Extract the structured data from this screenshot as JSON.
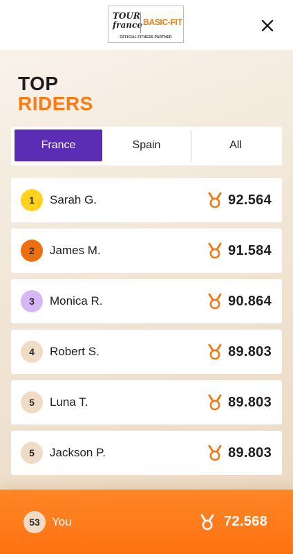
{
  "header": {
    "logo": {
      "tdf_line1": "TOUR",
      "tdf_line2": "france",
      "brand": "BASIC-FIT",
      "partner_text": "OFFICIAL FITNESS PARTNER"
    },
    "close_icon": "close-icon"
  },
  "title": {
    "line1": "TOP",
    "line2": "RIDERS"
  },
  "tabs": [
    {
      "label": "France",
      "active": true
    },
    {
      "label": "Spain",
      "active": false
    },
    {
      "label": "All",
      "active": false
    }
  ],
  "riders": [
    {
      "rank": "1",
      "name": "Sarah G.",
      "score": "92.564",
      "badge_color": "#ffd21f"
    },
    {
      "rank": "2",
      "name": "James M.",
      "score": "91.584",
      "badge_color": "#ee6f10"
    },
    {
      "rank": "3",
      "name": "Monica R.",
      "score": "90.864",
      "badge_color": "#d6b6f4"
    },
    {
      "rank": "4",
      "name": "Robert S.",
      "score": "89.803",
      "badge_color": "#f0dcc6"
    },
    {
      "rank": "5",
      "name": "Luna T.",
      "score": "89.803",
      "badge_color": "#f0dcc6"
    },
    {
      "rank": "5",
      "name": "Jackson P.",
      "score": "89.803",
      "badge_color": "#f0dcc6"
    }
  ],
  "you": {
    "rank": "53",
    "label": "You",
    "score": "72.568"
  },
  "colors": {
    "accent_orange": "#ff7a12",
    "active_tab_purple": "#5b2db5",
    "medal": "medal-icon"
  }
}
